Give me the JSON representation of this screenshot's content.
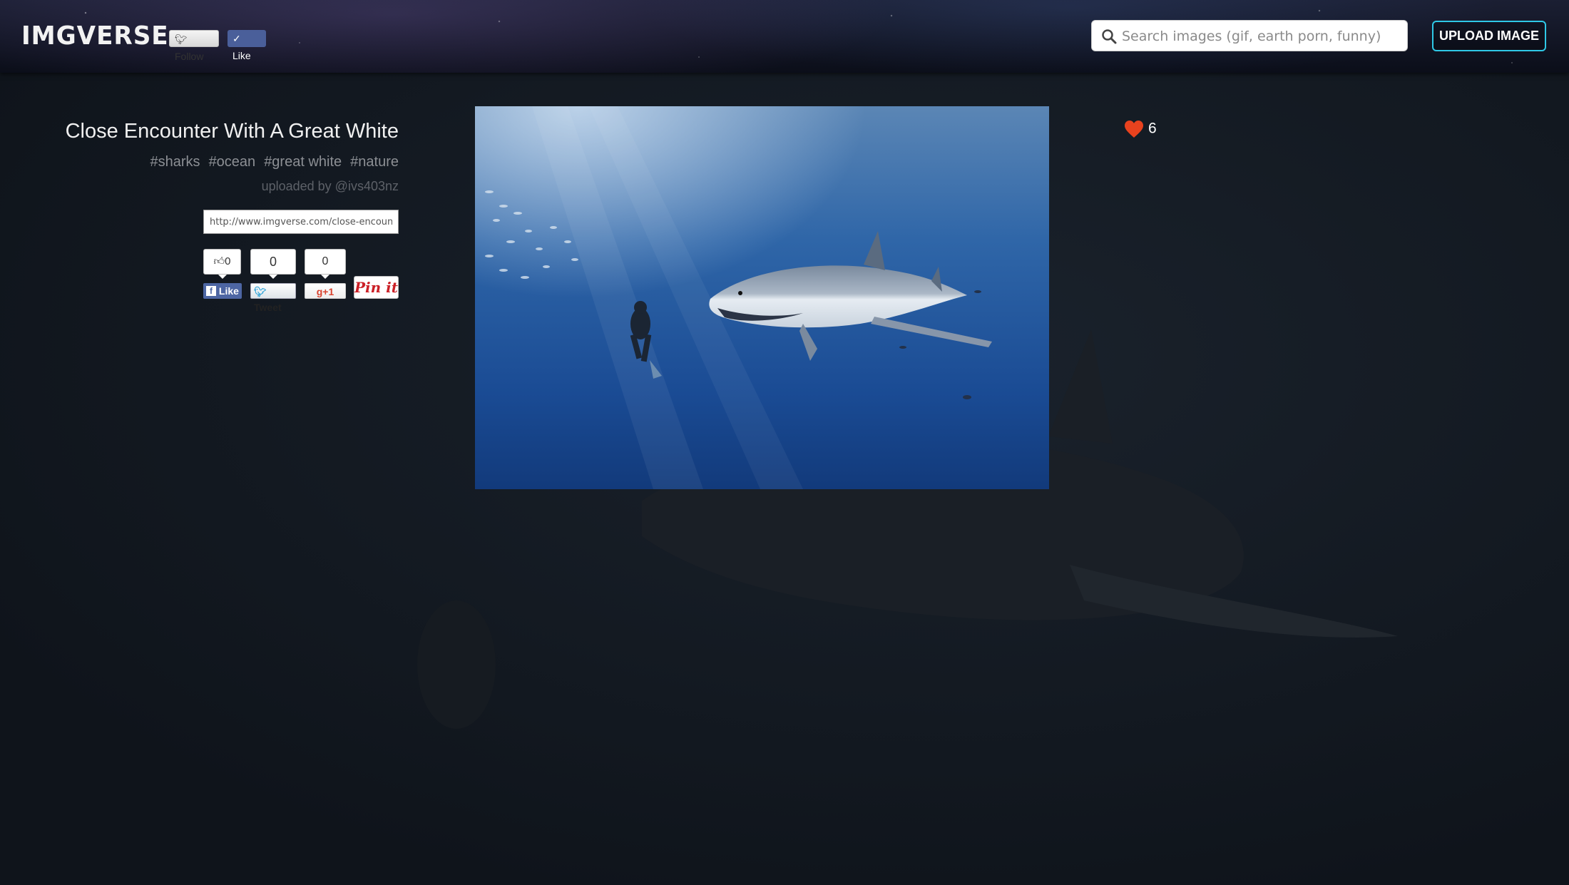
{
  "header": {
    "logo": "IMGVERSE",
    "follow_label": "Follow",
    "like_label": "Like",
    "search_placeholder": "Search images (gif, earth porn, funny)",
    "upload_label": "UPLOAD IMAGE"
  },
  "post": {
    "title": "Close Encounter With A Great White",
    "tags": [
      "#sharks",
      "#ocean",
      "#great white",
      "#nature"
    ],
    "uploader": "uploaded by @ivs403nz",
    "share_url": "http://www.imgverse.com/close-encounter",
    "likes": "6"
  },
  "share": {
    "fb_count": "0",
    "fb_label": "Like",
    "tweet_count": "0",
    "tweet_label": "Tweet",
    "gplus_count": "0",
    "gplus_label": "+1",
    "pin_label": "Pin it"
  },
  "colors": {
    "accent": "#2fc8e6",
    "heart": "#e8421e",
    "background": "#121820"
  }
}
